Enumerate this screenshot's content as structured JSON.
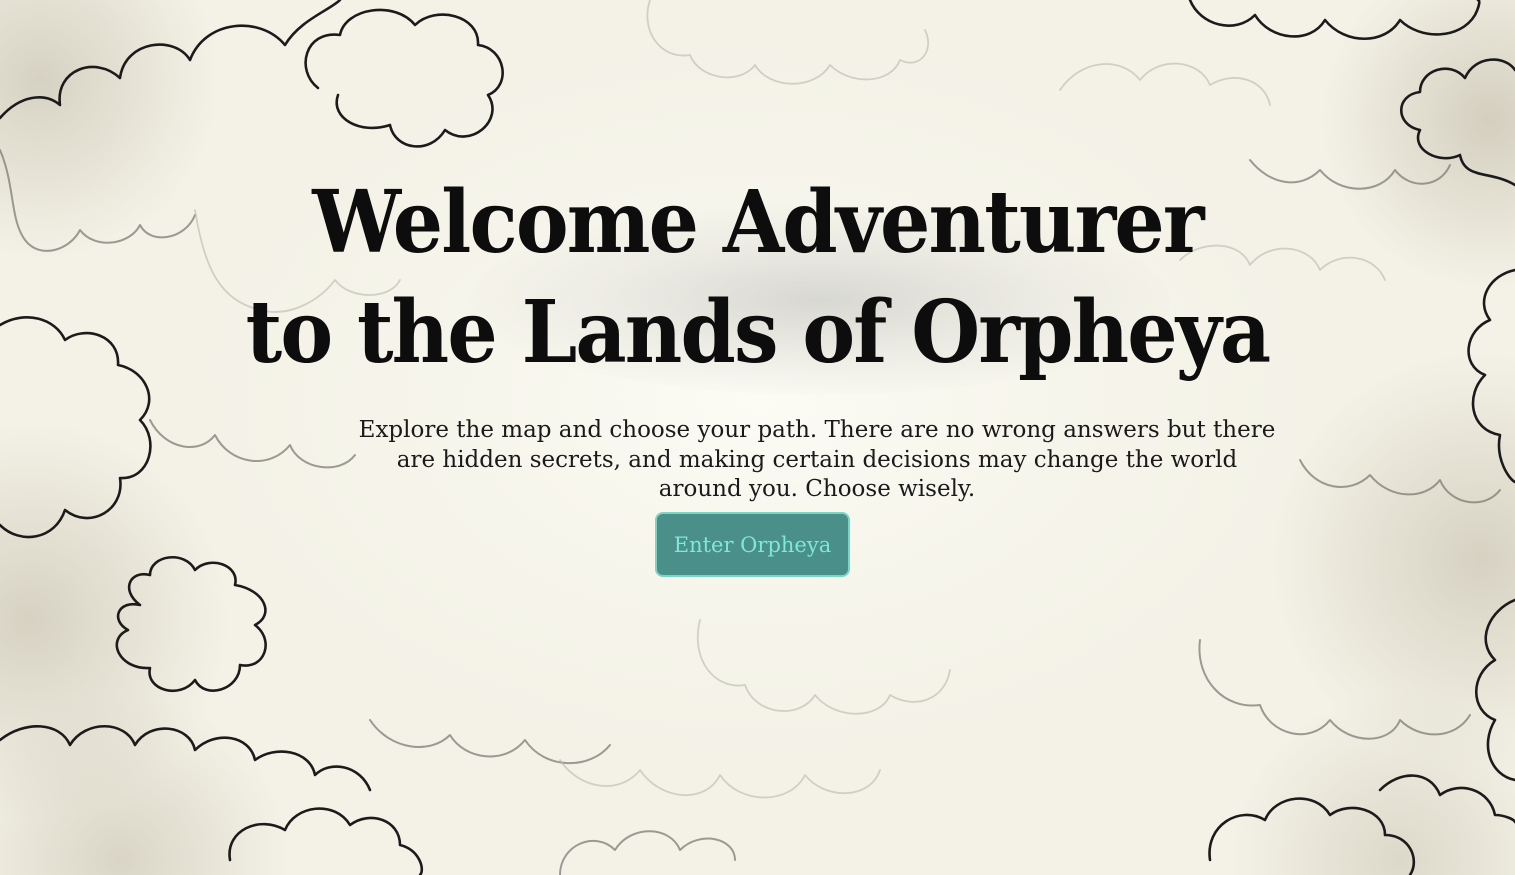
{
  "hero": {
    "title_line1": "Welcome Adventurer",
    "title_line2": "to the Lands of Orpheya",
    "description": "Explore the map and choose your path. There are no wrong answers but there are hidden secrets, and making certain decisions may change the world around you. Choose wisely.",
    "enter_button_label": "Enter Orpheya"
  },
  "colors": {
    "background": "#f4f2e7",
    "title_text": "#0d0d0d",
    "button_fill": "#4a8f89",
    "button_border": "#7cd4c2",
    "button_text": "#7fe9d4"
  },
  "decorations": {
    "background_art": "parchment-with-hand-drawn-clouds"
  }
}
